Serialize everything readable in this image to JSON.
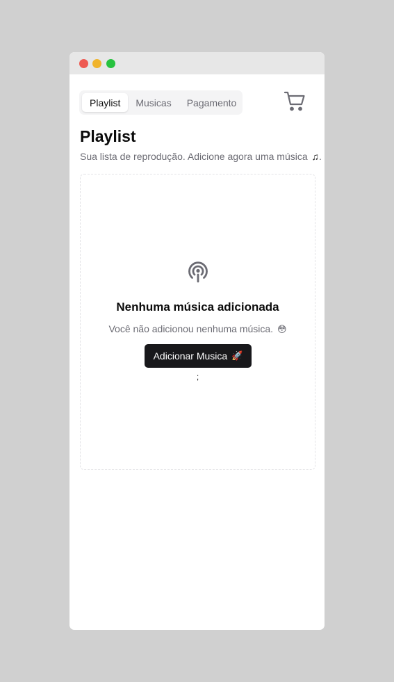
{
  "window": {
    "controls": [
      "close",
      "minimize",
      "maximize"
    ]
  },
  "tabs": [
    {
      "label": "Playlist",
      "active": true
    },
    {
      "label": "Musicas",
      "active": false
    },
    {
      "label": "Pagamento",
      "active": false
    }
  ],
  "header": {
    "cart_icon": "shopping-cart-icon",
    "title": "Playlist",
    "subtitle": "Sua lista de reprodução. Adicione agora uma música",
    "subtitle_icon": "♫",
    "subtitle_suffix": "."
  },
  "empty_state": {
    "icon": "podcast-icon",
    "title": "Nenhuma música adicionada",
    "text": "Você não adicionou nenhuma música.",
    "text_emoji": "😳",
    "button_label": "Adicionar Musica",
    "button_emoji": "🚀",
    "stray_text": ";"
  },
  "colors": {
    "background": "#d0d0d0",
    "button": "#18181b",
    "muted_text": "#6b6b73"
  }
}
